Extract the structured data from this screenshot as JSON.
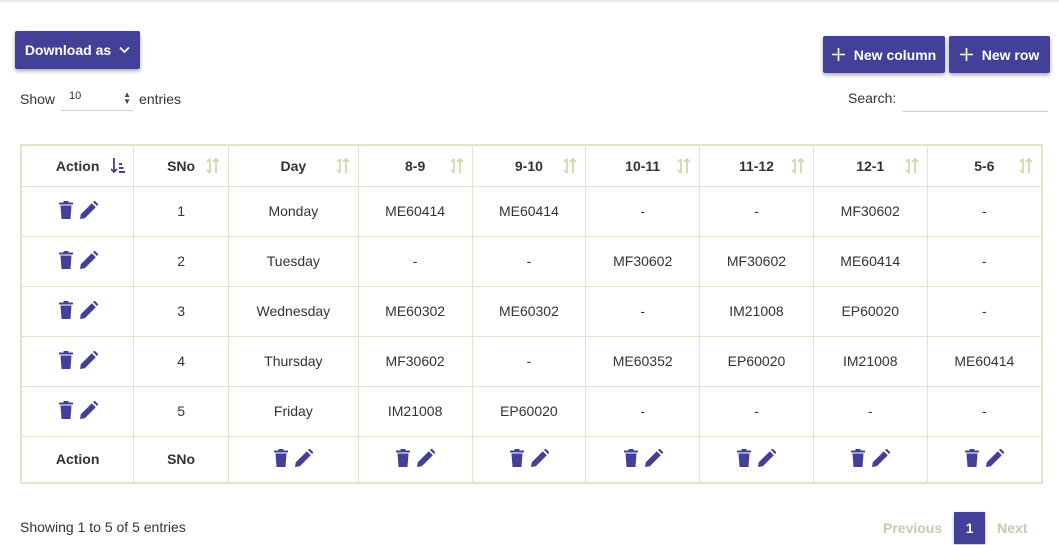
{
  "toolbar": {
    "download_label": "Download as",
    "new_column_label": "New column",
    "new_row_label": "New row"
  },
  "controls": {
    "show_prefix": "Show",
    "show_value": "10",
    "show_suffix": "entries",
    "search_label": "Search:",
    "search_value": ""
  },
  "table": {
    "columns": [
      "Action",
      "SNo",
      "Day",
      "8-9",
      "9-10",
      "10-11",
      "11-12",
      "12-1",
      "5-6"
    ],
    "rows": [
      {
        "sno": "1",
        "day": "Monday",
        "slots": [
          "ME60414",
          "ME60414",
          "-",
          "-",
          "MF30602",
          "-"
        ]
      },
      {
        "sno": "2",
        "day": "Tuesday",
        "slots": [
          "-",
          "-",
          "MF30602",
          "MF30602",
          "ME60414",
          "-"
        ]
      },
      {
        "sno": "3",
        "day": "Wednesday",
        "slots": [
          "ME60302",
          "ME60302",
          "-",
          "IM21008",
          "EP60020",
          "-"
        ]
      },
      {
        "sno": "4",
        "day": "Thursday",
        "slots": [
          "MF30602",
          "-",
          "ME60352",
          "EP60020",
          "IM21008",
          "ME60414"
        ]
      },
      {
        "sno": "5",
        "day": "Friday",
        "slots": [
          "IM21008",
          "EP60020",
          "-",
          "-",
          "-",
          "-"
        ]
      }
    ],
    "footer": {
      "action": "Action",
      "sno": "SNo"
    }
  },
  "info_text": "Showing 1 to 5 of 5 entries",
  "pagination": {
    "previous": "Previous",
    "current": "1",
    "next": "Next"
  },
  "colors": {
    "accent": "#43409a",
    "border": "#e4e2cc",
    "sort_icon": "#d8d4b2",
    "pager_disabled": "#cdc9a8"
  },
  "icons": {
    "delete": "trash-icon",
    "edit": "pencil-icon",
    "sort": "sort-icon",
    "sort_active": "sort-asc-icon",
    "dropdown": "chevron-down-icon",
    "add": "plus-icon"
  }
}
